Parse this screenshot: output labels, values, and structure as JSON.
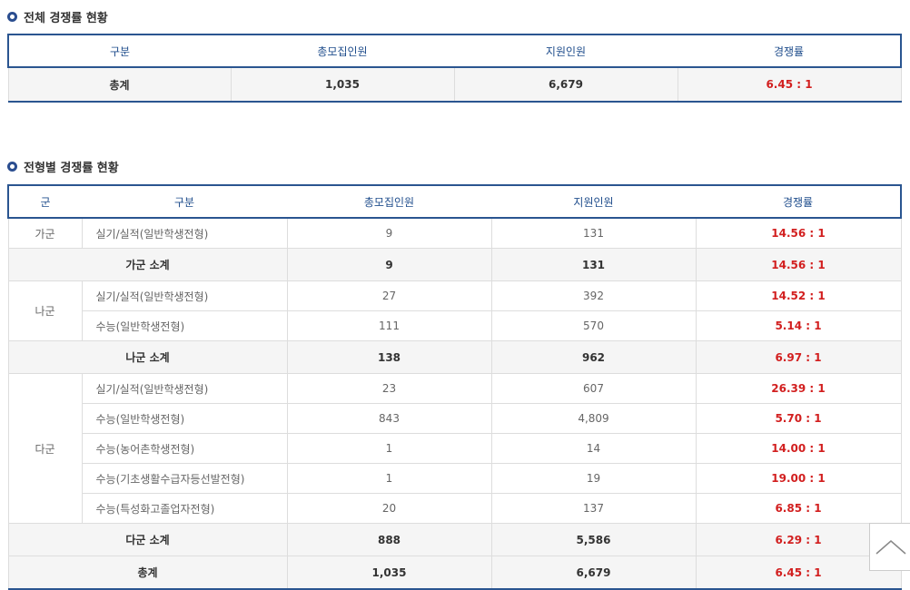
{
  "section1": {
    "title": "전체 경쟁률 현황",
    "headers": [
      "구분",
      "총모집인원",
      "지원인원",
      "경쟁률"
    ],
    "row": [
      "총계",
      "1,035",
      "6,679",
      "6.45 : 1"
    ]
  },
  "section2": {
    "title": "전형별 경쟁률 현황",
    "headers": [
      "군",
      "구분",
      "총모집인원",
      "지원인원",
      "경쟁률"
    ],
    "rows": [
      {
        "group": "가군",
        "name": "실기/실적(일반학생전형)",
        "quota": "9",
        "applicants": "131",
        "rate": "14.56 : 1"
      },
      {
        "subtotal": "가군 소계",
        "quota": "9",
        "applicants": "131",
        "rate": "14.56 : 1"
      },
      {
        "group": "나군",
        "name": "실기/실적(일반학생전형)",
        "quota": "27",
        "applicants": "392",
        "rate": "14.52 : 1"
      },
      {
        "name": "수능(일반학생전형)",
        "quota": "111",
        "applicants": "570",
        "rate": "5.14 : 1"
      },
      {
        "subtotal": "나군 소계",
        "quota": "138",
        "applicants": "962",
        "rate": "6.97 : 1"
      },
      {
        "group": "다군",
        "name": "실기/실적(일반학생전형)",
        "quota": "23",
        "applicants": "607",
        "rate": "26.39 : 1"
      },
      {
        "name": "수능(일반학생전형)",
        "quota": "843",
        "applicants": "4,809",
        "rate": "5.70 : 1"
      },
      {
        "name": "수능(농어촌학생전형)",
        "quota": "1",
        "applicants": "14",
        "rate": "14.00 : 1"
      },
      {
        "name": "수능(기초생활수급자등선발전형)",
        "quota": "1",
        "applicants": "19",
        "rate": "19.00 : 1"
      },
      {
        "name": "수능(특성화고졸업자전형)",
        "quota": "20",
        "applicants": "137",
        "rate": "6.85 : 1"
      },
      {
        "subtotal": "다군 소계",
        "quota": "888",
        "applicants": "5,586",
        "rate": "6.29 : 1"
      },
      {
        "subtotal": "총계",
        "quota": "1,035",
        "applicants": "6,679",
        "rate": "6.45 : 1"
      }
    ]
  },
  "icons": {
    "bullet": "circle-bullet-icon",
    "top": "chevron-up-icon"
  }
}
